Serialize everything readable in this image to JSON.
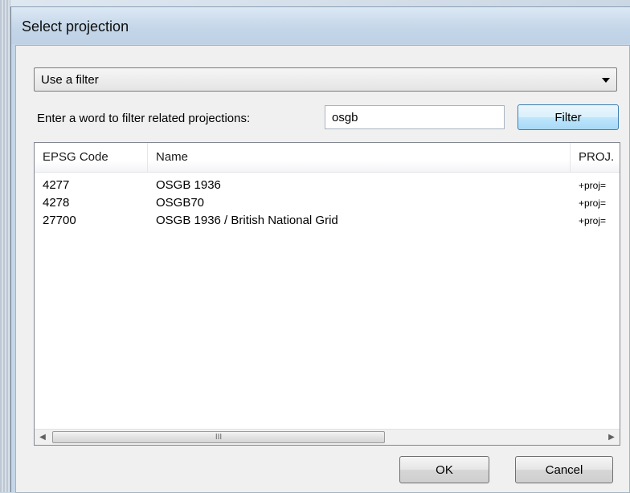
{
  "window": {
    "title": "Select projection"
  },
  "mode_select": {
    "selected": "Use a filter"
  },
  "filter": {
    "label": "Enter a word to filter related projections:",
    "value": "osgb",
    "button_label": "Filter"
  },
  "table": {
    "columns": [
      "EPSG Code",
      "Name",
      "PROJ."
    ],
    "rows": [
      {
        "code": "4277",
        "name": "OSGB 1936",
        "proj": "+proj="
      },
      {
        "code": "4278",
        "name": "OSGB70",
        "proj": "+proj="
      },
      {
        "code": "27700",
        "name": "OSGB 1936 / British National Grid",
        "proj": "+proj="
      }
    ],
    "scrollbar": {
      "thumb_grip": "III"
    }
  },
  "buttons": {
    "ok_label": "OK",
    "cancel_label": "Cancel"
  },
  "icons": {
    "dropdown": "chevron-down-icon",
    "scroll_left": "scroll-left-icon",
    "scroll_right": "scroll-right-icon"
  },
  "colors": {
    "filter_button_border": "#3c7fb1",
    "dialog_background": "#f0f0f0"
  }
}
